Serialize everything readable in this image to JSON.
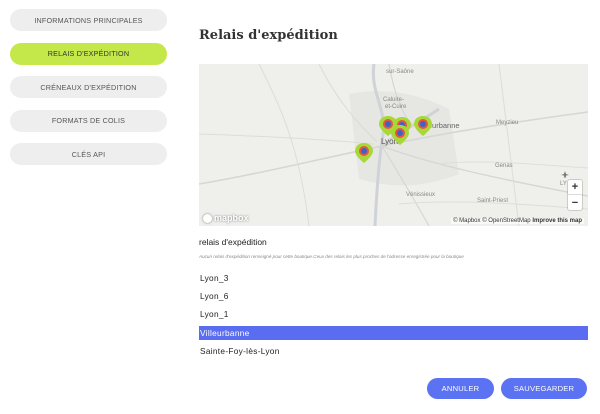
{
  "sidebar": {
    "items": [
      {
        "label": "Informations principales",
        "active": false
      },
      {
        "label": "Relais d'expédition",
        "active": true
      },
      {
        "label": "Créneaux d'expédition",
        "active": false
      },
      {
        "label": "Formats de colis",
        "active": false
      },
      {
        "label": "Clés API",
        "active": false
      }
    ]
  },
  "main": {
    "title": "Relais d'expédition",
    "map": {
      "places": {
        "north": "sur-Saône",
        "caluire": "Caluire-",
        "caluire2": "et-Cuire",
        "lyon": "Lyon",
        "villeurbanne": "Villeurbanne",
        "meyzieu": "Meyzieu",
        "genas": "Genas",
        "venissieux": "Vénissieux",
        "saint_priest": "Saint-Priest",
        "ly": "LY"
      },
      "zoom_in": "+",
      "zoom_out": "−",
      "logo": "mapbox",
      "attribution": {
        "mapbox": "© Mapbox",
        "osm": "© OpenStreetMap",
        "improve": "Improve this map"
      }
    },
    "section_label": "relais d'expédition",
    "section_hint": "Aucun relais d'expédition renseigné pour cette boutique.Ceux des relais les plus proches de l'adresse enregistrée pour la boutique",
    "relays": [
      "Lyon_3",
      "Lyon_6",
      "Lyon_1",
      "Villeurbanne",
      "Sainte-Foy-lès-Lyon"
    ],
    "selected_relay": "Villeurbanne",
    "buttons": {
      "cancel": "Annuler",
      "save": "Sauvegarder"
    }
  },
  "colors": {
    "accent_green": "#c4e84a",
    "primary_blue": "#5b72f2",
    "selection_blue": "#5a6cf0",
    "marker_green": "#a8d838"
  },
  "icons": {
    "marker": "map-marker-icon",
    "zoom_in": "zoom-in-icon",
    "zoom_out": "zoom-out-icon",
    "airport": "airplane-icon"
  }
}
